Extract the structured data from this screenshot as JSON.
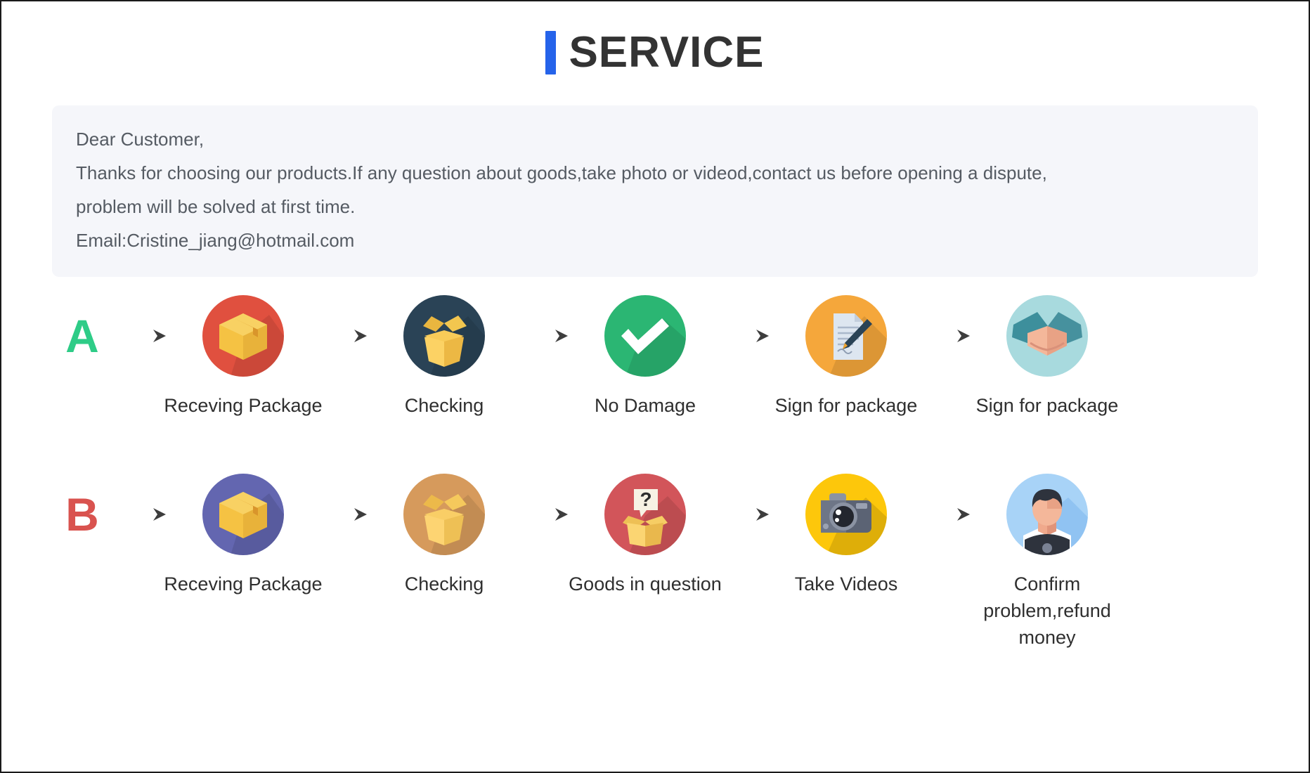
{
  "header": {
    "accent_color": "#2563ea",
    "title": "SERVICE"
  },
  "notice": {
    "line1": "Dear Customer,",
    "line2": "Thanks for choosing our products.If any question about goods,take photo or videod,contact us before opening a dispute,",
    "line3": "problem will be solved at first time.",
    "line4": "Email:Cristine_jiang@hotmail.com"
  },
  "flows": [
    {
      "letter": "A",
      "letter_color": "#2ecc87",
      "steps": [
        {
          "label": "Receving Package",
          "icon": "closed-box-icon",
          "circle_color": "#e0503f"
        },
        {
          "label": "Checking",
          "icon": "open-box-icon",
          "circle_color": "#2a4356"
        },
        {
          "label": "No Damage",
          "icon": "checkmark-icon",
          "circle_color": "#2bb673"
        },
        {
          "label": "Sign for package",
          "icon": "document-pen-icon",
          "circle_color": "#f5a73b"
        },
        {
          "label": "Sign for package",
          "icon": "handshake-icon",
          "circle_color": "#a8dade"
        }
      ]
    },
    {
      "letter": "B",
      "letter_color": "#d9534f",
      "steps": [
        {
          "label": "Receving Package",
          "icon": "closed-box-icon",
          "circle_color": "#6366b0"
        },
        {
          "label": "Checking",
          "icon": "open-box-icon",
          "circle_color": "#d69a5c"
        },
        {
          "label": "Goods in question",
          "icon": "question-box-icon",
          "circle_color": "#d2555a"
        },
        {
          "label": "Take Videos",
          "icon": "camera-icon",
          "circle_color": "#fdc70b"
        },
        {
          "label": "Confirm problem,refund money",
          "icon": "person-avatar-icon",
          "circle_color": "#a8d3f7"
        }
      ]
    }
  ]
}
